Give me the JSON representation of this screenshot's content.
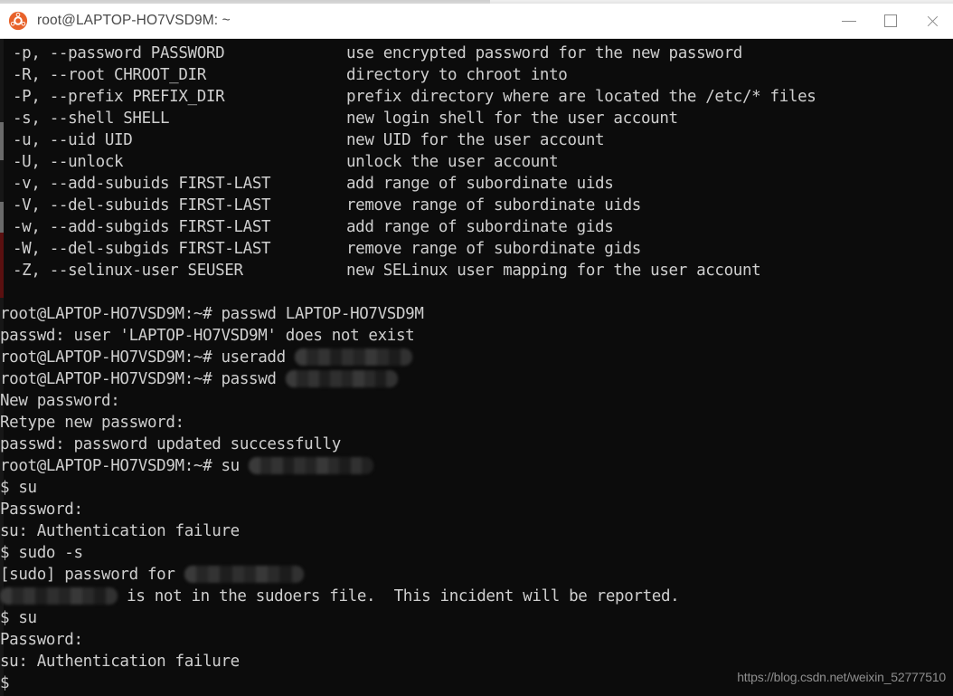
{
  "window": {
    "title": "root@LAPTOP-HO7VSD9M: ~",
    "icon": "ubuntu-logo",
    "controls": {
      "minimize": "—",
      "maximize": "☐",
      "close": "✕"
    }
  },
  "theme": {
    "terminal_background": "#0c0c0c",
    "terminal_foreground": "#cfcfcf",
    "titlebar_background": "#ffffff",
    "titlebar_foreground": "#4a4a4a",
    "accent": "#e8622a"
  },
  "terminal": {
    "help_options": [
      {
        "flag": "-p, --password PASSWORD",
        "desc": "use encrypted password for the new password"
      },
      {
        "flag": "-R, --root CHROOT_DIR",
        "desc": "directory to chroot into"
      },
      {
        "flag": "-P, --prefix PREFIX_DIR",
        "desc": "prefix directory where are located the /etc/* files"
      },
      {
        "flag": "-s, --shell SHELL",
        "desc": "new login shell for the user account"
      },
      {
        "flag": "-u, --uid UID",
        "desc": "new UID for the user account"
      },
      {
        "flag": "-U, --unlock",
        "desc": "unlock the user account"
      },
      {
        "flag": "-v, --add-subuids FIRST-LAST",
        "desc": "add range of subordinate uids"
      },
      {
        "flag": "-V, --del-subuids FIRST-LAST",
        "desc": "remove range of subordinate uids"
      },
      {
        "flag": "-w, --add-subgids FIRST-LAST",
        "desc": "add range of subordinate gids"
      },
      {
        "flag": "-W, --del-subgids FIRST-LAST",
        "desc": "remove range of subordinate gids"
      },
      {
        "flag": "-Z, --selinux-user SEUSER",
        "desc": "new SELinux user mapping for the user account"
      }
    ],
    "session": [
      {
        "text": "root@LAPTOP-HO7VSD9M:~# passwd LAPTOP-HO7VSD9M"
      },
      {
        "text": "passwd: user 'LAPTOP-HO7VSD9M' does not exist"
      },
      {
        "text": "root@LAPTOP-HO7VSD9M:~# useradd ",
        "redacted_width": 130
      },
      {
        "text": "root@LAPTOP-HO7VSD9M:~# passwd ",
        "redacted_width": 124
      },
      {
        "text": "New password:"
      },
      {
        "text": "Retype new password:"
      },
      {
        "text": "passwd: password updated successfully"
      },
      {
        "text": "root@LAPTOP-HO7VSD9M:~# su ",
        "redacted_width": 138
      },
      {
        "text": "$ su"
      },
      {
        "text": "Password:"
      },
      {
        "text": "su: Authentication failure"
      },
      {
        "text": "$ sudo -s"
      },
      {
        "text": "[sudo] password for ",
        "redacted_width": 132
      },
      {
        "text": "",
        "redacted_width": 130,
        "suffix": " is not in the sudoers file.  This incident will be reported."
      },
      {
        "text": "$ su"
      },
      {
        "text": "Password:"
      },
      {
        "text": "su: Authentication failure"
      },
      {
        "text": "$"
      }
    ]
  },
  "watermark": {
    "text": "https://blog.csdn.net/weixin_52777510"
  }
}
